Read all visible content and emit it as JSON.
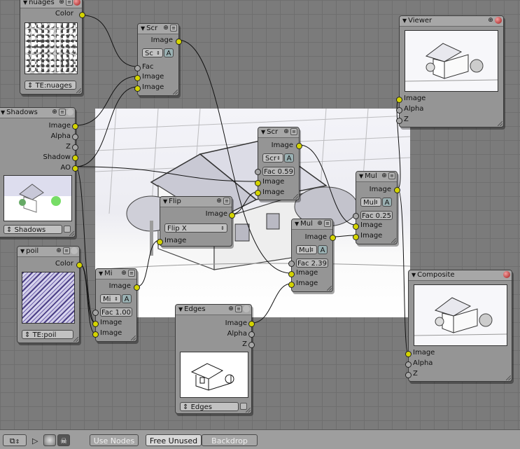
{
  "nodes": {
    "nuages": {
      "title": "nuages",
      "out_color": "Color",
      "texture": "TE:nuages"
    },
    "screen1": {
      "title": "Scr",
      "out_image": "Image",
      "blend": "Sc",
      "alpha_btn": "A",
      "in_fac": "Fac",
      "in_image1": "Image",
      "in_image2": "Image"
    },
    "shadows": {
      "title": "Shadows",
      "out_image": "Image",
      "out_alpha": "Alpha",
      "out_z": "Z",
      "out_shadow": "Shadow",
      "out_ao": "AO",
      "scene": "Shadows"
    },
    "poil": {
      "title": "poil",
      "out_color": "Color",
      "texture": "TE:poil"
    },
    "mix": {
      "title": "Mi",
      "out_image": "Image",
      "blend": "Mi",
      "alpha_btn": "A",
      "fac": "Fac 1.00",
      "in_image1": "Image",
      "in_image2": "Image"
    },
    "flip": {
      "title": "Flip",
      "out_image": "Image",
      "mode": "Flip X",
      "in_image": "Image"
    },
    "screen2": {
      "title": "Scr",
      "out_image": "Image",
      "blend": "Scr",
      "alpha_btn": "A",
      "fac": "Fac 0.59",
      "in_image1": "Image",
      "in_image2": "Image"
    },
    "mul2": {
      "title": "Mul",
      "out_image": "Image",
      "blend": "Mul",
      "alpha_btn": "A",
      "fac": "Fac 2.39",
      "in_image1": "Image",
      "in_image2": "Image"
    },
    "mul1": {
      "title": "Mul",
      "out_image": "Image",
      "blend": "Mul",
      "alpha_btn": "A",
      "fac": "Fac 0.25",
      "in_image1": "Image",
      "in_image2": "Image"
    },
    "edges": {
      "title": "Edges",
      "out_image": "Image",
      "out_alpha": "Alpha",
      "out_z": "Z",
      "scene": "Edges"
    },
    "viewer": {
      "title": "Viewer",
      "in_image": "Image",
      "in_alpha": "Alpha",
      "in_z": "Z"
    },
    "composite": {
      "title": "Composite",
      "in_image": "Image",
      "in_alpha": "Alpha",
      "in_z": "Z"
    }
  },
  "statusbar": {
    "use_nodes": "Use Nodes",
    "free_unused": "Free Unused",
    "backdrop": "Backdrop"
  },
  "colors": {
    "grid_bg": "#7b7b7b",
    "node_bg": "#959595",
    "socket_image": "#d4d400",
    "socket_value": "#a6a6a6",
    "alpha_button": "#9ab1b3"
  }
}
